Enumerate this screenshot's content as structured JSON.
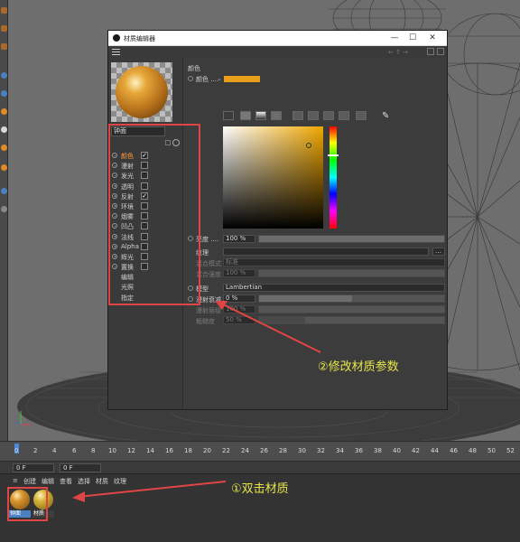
{
  "dialog": {
    "title": "材质编辑器",
    "win_min": "—",
    "win_max": "☐",
    "win_close": "✕"
  },
  "material": {
    "name_field": "钟面",
    "channels": [
      {
        "label": "颜色",
        "checked": true,
        "selected": true
      },
      {
        "label": "漫射",
        "checked": false
      },
      {
        "label": "发光",
        "checked": false
      },
      {
        "label": "透明",
        "checked": false
      },
      {
        "label": "反射",
        "checked": true
      },
      {
        "label": "环境",
        "checked": false
      },
      {
        "label": "烟雾",
        "checked": false
      },
      {
        "label": "凹凸",
        "checked": false
      },
      {
        "label": "法线",
        "checked": false
      },
      {
        "label": "Alpha",
        "checked": false
      },
      {
        "label": "辉光",
        "checked": false
      },
      {
        "label": "置换",
        "checked": false
      },
      {
        "label": "编辑",
        "checked": null
      },
      {
        "label": "光照",
        "checked": null
      },
      {
        "label": "指定",
        "checked": null
      }
    ]
  },
  "color_section": {
    "title": "颜色",
    "color_label": "颜色 ....",
    "brightness_label": "亮度 ....",
    "brightness_value": "100 %",
    "texture_label": "纹理",
    "mix_mode_label": "混合模式",
    "mix_mode_value": "标准",
    "mix_strength_label": "混合强度",
    "mix_strength_value": "100 %",
    "model_label": "模型",
    "model_value": "Lambertian",
    "diffuse_falloff_label": "漫射衰减",
    "diffuse_falloff_value": "0 %",
    "diffuse_level_label": "漫射层级",
    "diffuse_level_value": "100 %",
    "roughness_label": "粗糙度",
    "roughness_value": "50 %",
    "accent_color": "#e8a01b"
  },
  "timeline": {
    "ticks": [
      "0",
      "2",
      "4",
      "6",
      "8",
      "10",
      "12",
      "14",
      "16",
      "18",
      "20",
      "22",
      "24",
      "26",
      "28",
      "30",
      "32",
      "34",
      "36",
      "38",
      "40",
      "42",
      "44",
      "46",
      "48",
      "50",
      "52"
    ],
    "frame_start": "0 F",
    "frame_end": "0 F"
  },
  "material_manager": {
    "menu": [
      "创建",
      "编辑",
      "查看",
      "选择",
      "材质",
      "纹理"
    ],
    "materials": [
      {
        "label": "钟面"
      },
      {
        "label": "材质"
      }
    ]
  },
  "annotations": {
    "step1": "①双击材质",
    "step2": "②修改材质参数"
  }
}
